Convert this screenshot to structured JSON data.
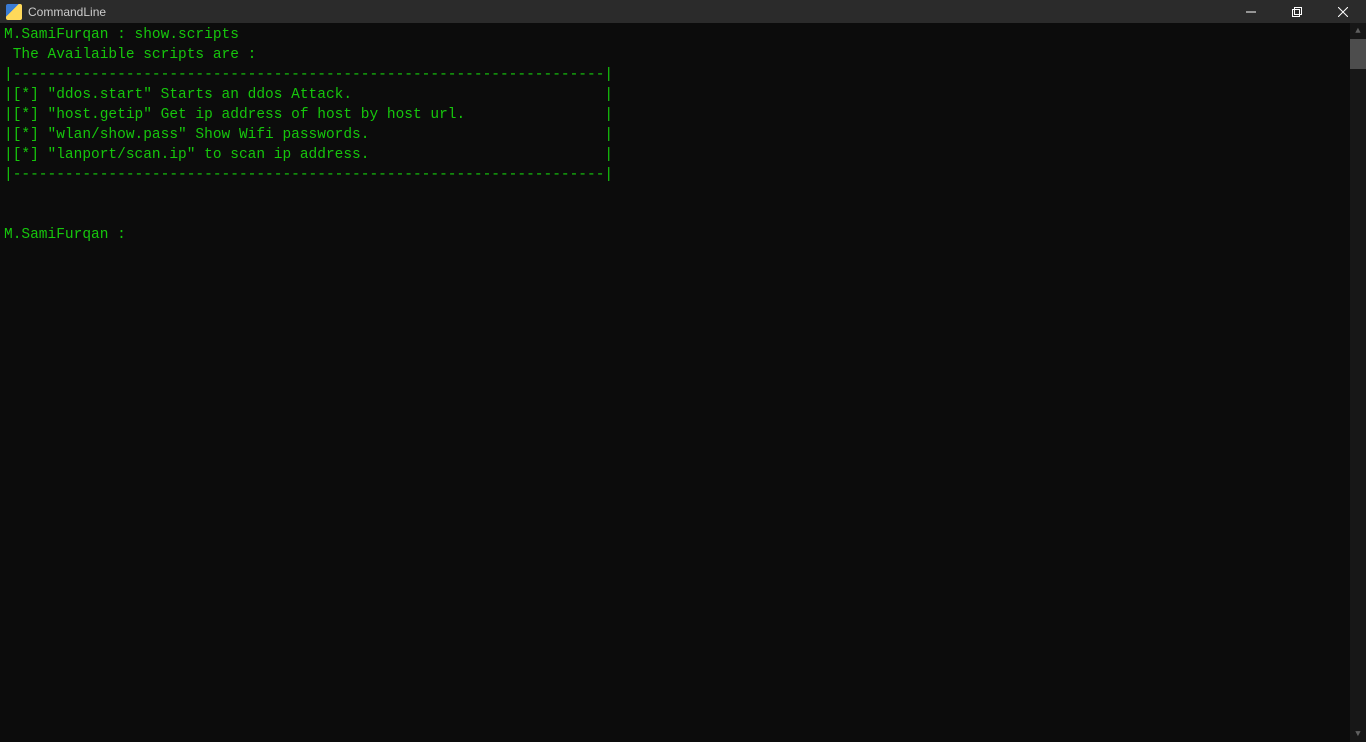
{
  "window": {
    "title": "CommandLine"
  },
  "terminal": {
    "lines": {
      "l0": "M.SamiFurqan : show.scripts",
      "l1": " The Availaible scripts are :",
      "l2": "|--------------------------------------------------------------------|",
      "l3": "|[*] \"ddos.start\" Starts an ddos Attack.                             |",
      "l4": "|[*] \"host.getip\" Get ip address of host by host url.                |",
      "l5": "|[*] \"wlan/show.pass\" Show Wifi passwords.                           |",
      "l6": "|[*] \"lanport/scan.ip\" to scan ip address.                           |",
      "l7": "|--------------------------------------------------------------------|",
      "l8": "",
      "l9": "",
      "l10": "M.SamiFurqan : "
    }
  }
}
